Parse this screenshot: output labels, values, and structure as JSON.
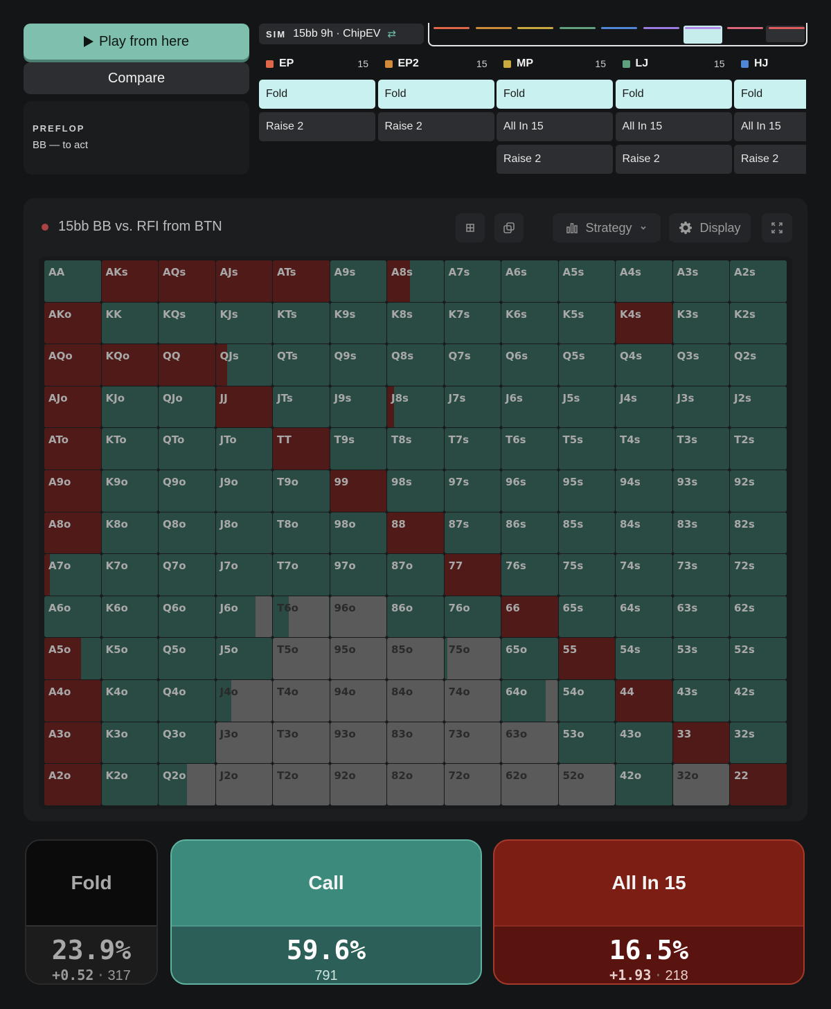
{
  "controls": {
    "play_label": "Play from here",
    "compare_label": "Compare",
    "street": "PREFLOP",
    "to_act": "BB — to act"
  },
  "sim": {
    "tag": "SIM",
    "label": "15bb 9h · ChipEV",
    "swap_icon": "⇄"
  },
  "timeline": {
    "colors": [
      "#e0664a",
      "#cc8a3a",
      "#c9a83f",
      "#5fa07e",
      "#4f86d6",
      "#9b7ae0",
      "#b48ae8",
      "#d9667a",
      "#e05c5c"
    ]
  },
  "positions": [
    {
      "name": "EP",
      "stack": "15",
      "color": "#e0664a",
      "actions": [
        {
          "label": "Fold",
          "selected": true
        },
        {
          "label": "Raise 2",
          "selected": false
        }
      ]
    },
    {
      "name": "EP2",
      "stack": "15",
      "color": "#d18a3a",
      "actions": [
        {
          "label": "Fold",
          "selected": true
        },
        {
          "label": "Raise 2",
          "selected": false
        }
      ]
    },
    {
      "name": "MP",
      "stack": "15",
      "color": "#c9a83f",
      "actions": [
        {
          "label": "Fold",
          "selected": true
        },
        {
          "label": "All In 15",
          "selected": false
        },
        {
          "label": "Raise 2",
          "selected": false
        }
      ]
    },
    {
      "name": "LJ",
      "stack": "15",
      "color": "#5fa07e",
      "actions": [
        {
          "label": "Fold",
          "selected": true
        },
        {
          "label": "All In 15",
          "selected": false
        },
        {
          "label": "Raise 2",
          "selected": false
        }
      ]
    },
    {
      "name": "HJ",
      "stack": "",
      "color": "#4f86d6",
      "actions": [
        {
          "label": "Fold",
          "selected": true
        },
        {
          "label": "All In 15",
          "selected": false
        },
        {
          "label": "Raise 2",
          "selected": false
        }
      ]
    }
  ],
  "panel": {
    "title": "15bb BB vs. RFI from BTN",
    "strategy_label": "Strategy",
    "display_label": "Display",
    "icons": [
      "grid-icon",
      "copy-icon",
      "bar-chart-icon",
      "chevron-down-icon",
      "gear-icon",
      "expand-icon"
    ]
  },
  "colors": {
    "fold": "#5a5a5a",
    "call": "#2a4a44",
    "allin": "#4f1a17"
  },
  "grid": {
    "hands": [
      [
        "AA",
        "AKs",
        "AQs",
        "AJs",
        "ATs",
        "A9s",
        "A8s",
        "A7s",
        "A6s",
        "A5s",
        "A4s",
        "A3s",
        "A2s"
      ],
      [
        "AKo",
        "KK",
        "KQs",
        "KJs",
        "KTs",
        "K9s",
        "K8s",
        "K7s",
        "K6s",
        "K5s",
        "K4s",
        "K3s",
        "K2s"
      ],
      [
        "AQo",
        "KQo",
        "QQ",
        "QJs",
        "QTs",
        "Q9s",
        "Q8s",
        "Q7s",
        "Q6s",
        "Q5s",
        "Q4s",
        "Q3s",
        "Q2s"
      ],
      [
        "AJo",
        "KJo",
        "QJo",
        "JJ",
        "JTs",
        "J9s",
        "J8s",
        "J7s",
        "J6s",
        "J5s",
        "J4s",
        "J3s",
        "J2s"
      ],
      [
        "ATo",
        "KTo",
        "QTo",
        "JTo",
        "TT",
        "T9s",
        "T8s",
        "T7s",
        "T6s",
        "T5s",
        "T4s",
        "T3s",
        "T2s"
      ],
      [
        "A9o",
        "K9o",
        "Q9o",
        "J9o",
        "T9o",
        "99",
        "98s",
        "97s",
        "96s",
        "95s",
        "94s",
        "93s",
        "92s"
      ],
      [
        "A8o",
        "K8o",
        "Q8o",
        "J8o",
        "T8o",
        "98o",
        "88",
        "87s",
        "86s",
        "85s",
        "84s",
        "83s",
        "82s"
      ],
      [
        "A7o",
        "K7o",
        "Q7o",
        "J7o",
        "T7o",
        "97o",
        "87o",
        "77",
        "76s",
        "75s",
        "74s",
        "73s",
        "72s"
      ],
      [
        "A6o",
        "K6o",
        "Q6o",
        "J6o",
        "T6o",
        "96o",
        "86o",
        "76o",
        "66",
        "65s",
        "64s",
        "63s",
        "62s"
      ],
      [
        "A5o",
        "K5o",
        "Q5o",
        "J5o",
        "T5o",
        "95o",
        "85o",
        "75o",
        "65o",
        "55",
        "54s",
        "53s",
        "52s"
      ],
      [
        "A4o",
        "K4o",
        "Q4o",
        "J4o",
        "T4o",
        "94o",
        "84o",
        "74o",
        "64o",
        "54o",
        "44",
        "43s",
        "42s"
      ],
      [
        "A3o",
        "K3o",
        "Q3o",
        "J3o",
        "T3o",
        "93o",
        "83o",
        "73o",
        "63o",
        "53o",
        "43o",
        "33",
        "32s"
      ],
      [
        "A2o",
        "K2o",
        "Q2o",
        "J2o",
        "T2o",
        "92o",
        "82o",
        "72o",
        "62o",
        "52o",
        "42o",
        "32o",
        "22"
      ]
    ],
    "mix": [
      [
        [
          0,
          0,
          1
        ],
        [
          0,
          1,
          0
        ],
        [
          0,
          1,
          0
        ],
        [
          0,
          1,
          0
        ],
        [
          0,
          1,
          0
        ],
        [
          0,
          0,
          1
        ],
        [
          0,
          0.4,
          0.6
        ],
        [
          0,
          0,
          1
        ],
        [
          0,
          0,
          1
        ],
        [
          0,
          0,
          1
        ],
        [
          0,
          0,
          1
        ],
        [
          0,
          0,
          1
        ],
        [
          0,
          0,
          1
        ]
      ],
      [
        [
          0,
          1,
          0
        ],
        [
          0,
          0,
          1
        ],
        [
          0,
          0,
          1
        ],
        [
          0,
          0,
          1
        ],
        [
          0,
          0,
          1
        ],
        [
          0,
          0,
          1
        ],
        [
          0,
          0,
          1
        ],
        [
          0,
          0,
          1
        ],
        [
          0,
          0,
          1
        ],
        [
          0,
          0,
          1
        ],
        [
          0,
          1,
          0
        ],
        [
          0,
          0,
          1
        ],
        [
          0,
          0,
          1
        ]
      ],
      [
        [
          0,
          1,
          0
        ],
        [
          0,
          1,
          0
        ],
        [
          0,
          1,
          0
        ],
        [
          0,
          0.2,
          0.8
        ],
        [
          0,
          0,
          1
        ],
        [
          0,
          0,
          1
        ],
        [
          0,
          0,
          1
        ],
        [
          0,
          0,
          1
        ],
        [
          0,
          0,
          1
        ],
        [
          0,
          0,
          1
        ],
        [
          0,
          0,
          1
        ],
        [
          0,
          0,
          1
        ],
        [
          0,
          0,
          1
        ]
      ],
      [
        [
          0,
          1,
          0
        ],
        [
          0,
          0,
          1
        ],
        [
          0,
          0,
          1
        ],
        [
          0,
          1,
          0
        ],
        [
          0,
          0,
          1
        ],
        [
          0,
          0,
          1
        ],
        [
          0,
          0.12,
          0.88
        ],
        [
          0,
          0,
          1
        ],
        [
          0,
          0,
          1
        ],
        [
          0,
          0,
          1
        ],
        [
          0,
          0,
          1
        ],
        [
          0,
          0,
          1
        ],
        [
          0,
          0,
          1
        ]
      ],
      [
        [
          0,
          1,
          0
        ],
        [
          0,
          0,
          1
        ],
        [
          0,
          0,
          1
        ],
        [
          0,
          0,
          1
        ],
        [
          0,
          1,
          0
        ],
        [
          0,
          0,
          1
        ],
        [
          0,
          0,
          1
        ],
        [
          0,
          0,
          1
        ],
        [
          0,
          0,
          1
        ],
        [
          0,
          0,
          1
        ],
        [
          0,
          0,
          1
        ],
        [
          0,
          0,
          1
        ],
        [
          0,
          0,
          1
        ]
      ],
      [
        [
          0,
          1,
          0
        ],
        [
          0,
          0,
          1
        ],
        [
          0,
          0,
          1
        ],
        [
          0,
          0,
          1
        ],
        [
          0,
          0,
          1
        ],
        [
          0,
          1,
          0
        ],
        [
          0,
          0,
          1
        ],
        [
          0,
          0,
          1
        ],
        [
          0,
          0,
          1
        ],
        [
          0,
          0,
          1
        ],
        [
          0,
          0,
          1
        ],
        [
          0,
          0,
          1
        ],
        [
          0,
          0,
          1
        ]
      ],
      [
        [
          0,
          1,
          0
        ],
        [
          0,
          0,
          1
        ],
        [
          0,
          0,
          1
        ],
        [
          0,
          0,
          1
        ],
        [
          0,
          0,
          1
        ],
        [
          0,
          0,
          1
        ],
        [
          0,
          1,
          0
        ],
        [
          0,
          0,
          1
        ],
        [
          0,
          0,
          1
        ],
        [
          0,
          0,
          1
        ],
        [
          0,
          0,
          1
        ],
        [
          0,
          0,
          1
        ],
        [
          0,
          0,
          1
        ]
      ],
      [
        [
          0,
          0.1,
          0.9
        ],
        [
          0,
          0,
          1
        ],
        [
          0,
          0,
          1
        ],
        [
          0,
          0,
          1
        ],
        [
          0,
          0,
          1
        ],
        [
          0,
          0,
          1
        ],
        [
          0,
          0,
          1
        ],
        [
          0,
          1,
          0
        ],
        [
          0,
          0,
          1
        ],
        [
          0,
          0,
          1
        ],
        [
          0,
          0,
          1
        ],
        [
          0,
          0,
          1
        ],
        [
          0,
          0,
          1
        ]
      ],
      [
        [
          0,
          0,
          1
        ],
        [
          0,
          0,
          1
        ],
        [
          0,
          0,
          1
        ],
        [
          0.3,
          0,
          0.7
        ],
        [
          0.72,
          0,
          0.28
        ],
        [
          1,
          0,
          0
        ],
        [
          0,
          0,
          1
        ],
        [
          0,
          0,
          1
        ],
        [
          0,
          1,
          0
        ],
        [
          0,
          0,
          1
        ],
        [
          0,
          0,
          1
        ],
        [
          0,
          0,
          1
        ],
        [
          0,
          0,
          1
        ]
      ],
      [
        [
          0,
          0.65,
          0.35
        ],
        [
          0,
          0,
          1
        ],
        [
          0,
          0,
          1
        ],
        [
          0,
          0,
          1
        ],
        [
          1,
          0,
          0
        ],
        [
          1,
          0,
          0
        ],
        [
          1,
          0,
          0
        ],
        [
          0.95,
          0,
          0.05
        ],
        [
          0,
          0,
          1
        ],
        [
          0,
          1,
          0
        ],
        [
          0,
          0,
          1
        ],
        [
          0,
          0,
          1
        ],
        [
          0,
          0,
          1
        ]
      ],
      [
        [
          0,
          1,
          0
        ],
        [
          0,
          0,
          1
        ],
        [
          0,
          0,
          1
        ],
        [
          0.72,
          0,
          0.28
        ],
        [
          1,
          0,
          0
        ],
        [
          1,
          0,
          0
        ],
        [
          1,
          0,
          0
        ],
        [
          1,
          0,
          0
        ],
        [
          0.22,
          0,
          0.78
        ],
        [
          0,
          0,
          1
        ],
        [
          0,
          1,
          0
        ],
        [
          0,
          0,
          1
        ],
        [
          0,
          0,
          1
        ]
      ],
      [
        [
          0,
          1,
          0
        ],
        [
          0,
          0,
          1
        ],
        [
          0,
          0,
          1
        ],
        [
          1,
          0,
          0
        ],
        [
          1,
          0,
          0
        ],
        [
          1,
          0,
          0
        ],
        [
          1,
          0,
          0
        ],
        [
          1,
          0,
          0
        ],
        [
          1,
          0,
          0
        ],
        [
          0,
          0,
          1
        ],
        [
          0,
          0,
          1
        ],
        [
          0,
          1,
          0
        ],
        [
          0,
          0,
          1
        ]
      ],
      [
        [
          0,
          1,
          0
        ],
        [
          0,
          0,
          1
        ],
        [
          0.5,
          0,
          0.5
        ],
        [
          1,
          0,
          0
        ],
        [
          1,
          0,
          0
        ],
        [
          1,
          0,
          0
        ],
        [
          1,
          0,
          0
        ],
        [
          1,
          0,
          0
        ],
        [
          1,
          0,
          0
        ],
        [
          1,
          0,
          0
        ],
        [
          0,
          0,
          1
        ],
        [
          1,
          0,
          0
        ],
        [
          0,
          1,
          0
        ]
      ]
    ]
  },
  "summary": {
    "fold": {
      "label": "Fold",
      "pct": "23.9%",
      "ev": "+0.52",
      "sep": "·",
      "count": "317"
    },
    "call": {
      "label": "Call",
      "pct": "59.6%",
      "count": "791"
    },
    "allin": {
      "label": "All In 15",
      "pct": "16.5%",
      "ev": "+1.93",
      "sep": "·",
      "count": "218"
    }
  }
}
